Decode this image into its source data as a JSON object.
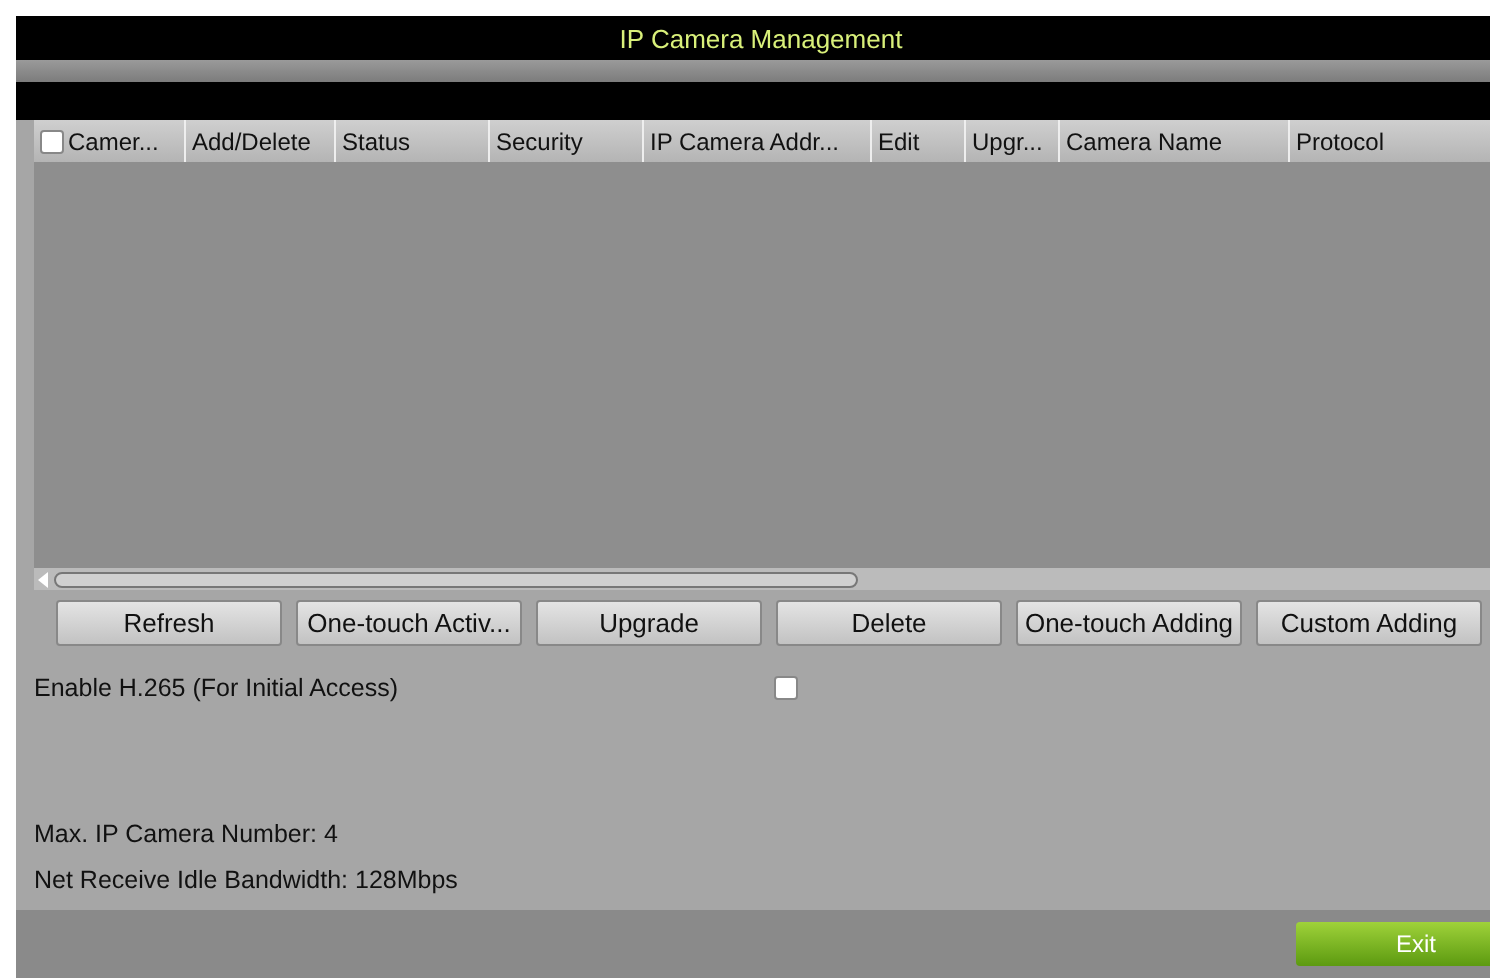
{
  "window": {
    "title": "IP Camera Management"
  },
  "table": {
    "select_all": {
      "checked": false
    },
    "columns": [
      "Camer...",
      "Add/Delete",
      "Status",
      "Security",
      "IP Camera Addr...",
      "Edit",
      "Upgr...",
      "Camera Name",
      "Protocol"
    ]
  },
  "buttons": [
    "Refresh",
    "One-touch Activ...",
    "Upgrade",
    "Delete",
    "One-touch Adding",
    "Custom Adding"
  ],
  "h265": {
    "label": "Enable H.265 (For Initial Access)",
    "checked": false
  },
  "info": [
    "Max. IP Camera Number: 4",
    "Net Receive Idle Bandwidth: 128Mbps"
  ],
  "footer": {
    "exit": "Exit"
  }
}
